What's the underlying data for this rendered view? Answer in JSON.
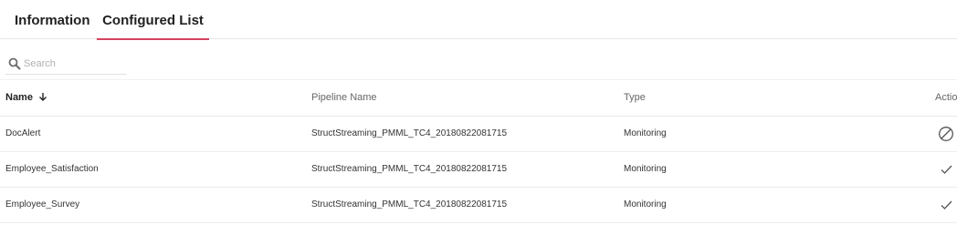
{
  "tabs": [
    {
      "label": "Information",
      "active": false
    },
    {
      "label": "Configured List",
      "active": true
    }
  ],
  "accent_color": "#d6425f",
  "search": {
    "placeholder": "Search",
    "value": "",
    "icon": "search-icon"
  },
  "table": {
    "columns": {
      "name": "Name",
      "pipeline": "Pipeline Name",
      "type": "Type",
      "action": "Actio"
    },
    "sort": {
      "column": "name",
      "direction": "descending",
      "icon": "arrow-down-icon"
    },
    "rows": [
      {
        "name": "DocAlert",
        "pipeline": "StructStreaming_PMML_TC4_20180822081715",
        "type": "Monitoring",
        "action_icon": "disabled-icon"
      },
      {
        "name": "Employee_Satisfaction",
        "pipeline": "StructStreaming_PMML_TC4_20180822081715",
        "type": "Monitoring",
        "action_icon": "check-icon"
      },
      {
        "name": "Employee_Survey",
        "pipeline": "StructStreaming_PMML_TC4_20180822081715",
        "type": "Monitoring",
        "action_icon": "check-icon"
      }
    ]
  }
}
